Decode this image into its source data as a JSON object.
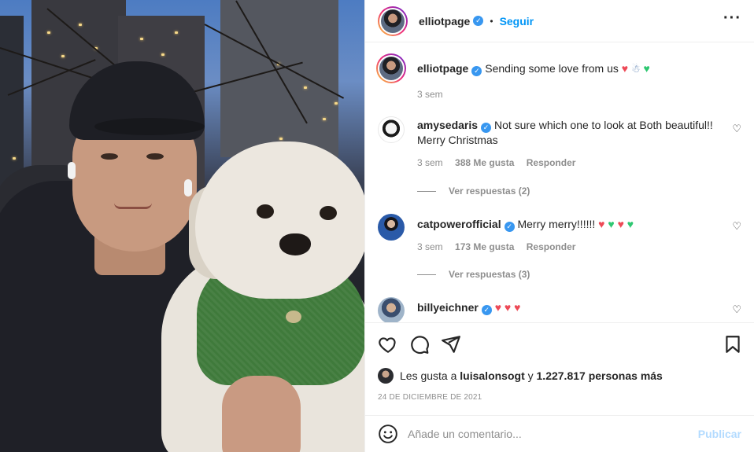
{
  "header": {
    "username": "elliotpage",
    "follow_label": "Seguir",
    "more_icon": "more-dots-icon"
  },
  "caption": {
    "username": "elliotpage",
    "text": "Sending some love from us",
    "time": "3 sem"
  },
  "comments": [
    {
      "username": "amysedaris",
      "text": "Not sure which one to look at Both beautiful!! Merry Christmas",
      "time": "3 sem",
      "likes": "388 Me gusta",
      "reply": "Responder",
      "view_replies": "Ver respuestas (2)"
    },
    {
      "username": "catpowerofficial",
      "text": "Merry merry!!!!!!",
      "time": "3 sem",
      "likes": "173 Me gusta",
      "reply": "Responder",
      "view_replies": "Ver respuestas (3)"
    },
    {
      "username": "billyeichner",
      "text": ""
    }
  ],
  "likes_summary": {
    "prefix": "Les gusta a",
    "user": "luisalonsogt",
    "middle": "y",
    "count": "1.227.817 personas más"
  },
  "date": "24 DE DICIEMBRE DE 2021",
  "add_comment": {
    "placeholder": "Añade un comentario...",
    "publish_label": "Publicar"
  },
  "colors": {
    "accent": "#0095f6",
    "verified": "#3897f0",
    "heart_red": "#ed4956",
    "heart_green": "#2ec771",
    "publish_disabled": "#b3dbff"
  }
}
